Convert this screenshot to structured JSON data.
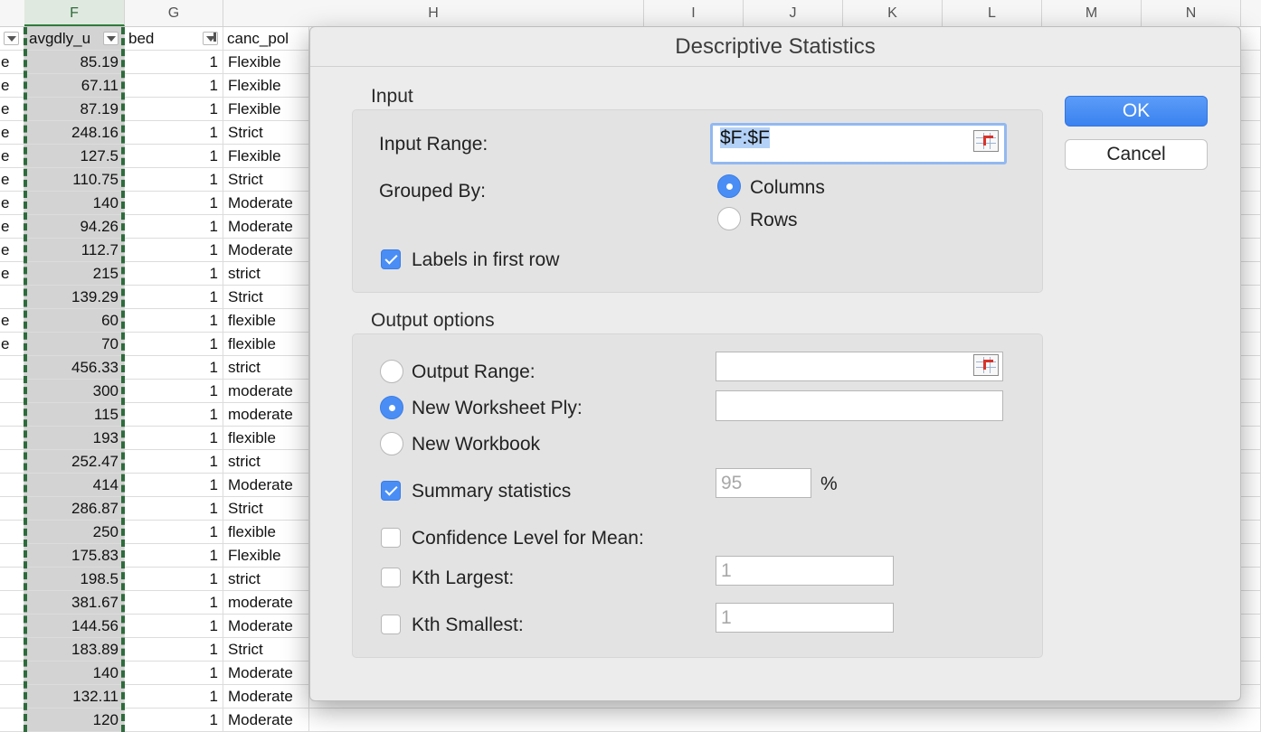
{
  "spreadsheet": {
    "column_headers": [
      "F",
      "G",
      "H",
      "I",
      "J",
      "K",
      "L",
      "M",
      "N"
    ],
    "selected_column": "F",
    "header_row": {
      "e": "",
      "f": "avgdly_u",
      "g": "bed",
      "h": "canc_pol"
    },
    "rows": [
      {
        "e": "e",
        "f": "85.19",
        "g": "1",
        "h": "Flexible"
      },
      {
        "e": "e",
        "f": "67.11",
        "g": "1",
        "h": "Flexible"
      },
      {
        "e": "e",
        "f": "87.19",
        "g": "1",
        "h": "Flexible"
      },
      {
        "e": "e",
        "f": "248.16",
        "g": "1",
        "h": "Strict"
      },
      {
        "e": "e",
        "f": "127.5",
        "g": "1",
        "h": "Flexible"
      },
      {
        "e": "e",
        "f": "110.75",
        "g": "1",
        "h": "Strict"
      },
      {
        "e": "e",
        "f": "140",
        "g": "1",
        "h": "Moderate"
      },
      {
        "e": "e",
        "f": "94.26",
        "g": "1",
        "h": "Moderate"
      },
      {
        "e": "e",
        "f": "112.7",
        "g": "1",
        "h": "Moderate"
      },
      {
        "e": "e",
        "f": "215",
        "g": "1",
        "h": "strict"
      },
      {
        "e": "",
        "f": "139.29",
        "g": "1",
        "h": "Strict"
      },
      {
        "e": "e",
        "f": "60",
        "g": "1",
        "h": "flexible"
      },
      {
        "e": "e",
        "f": "70",
        "g": "1",
        "h": "flexible"
      },
      {
        "e": "",
        "f": "456.33",
        "g": "1",
        "h": "strict"
      },
      {
        "e": "",
        "f": "300",
        "g": "1",
        "h": "moderate"
      },
      {
        "e": "",
        "f": "115",
        "g": "1",
        "h": "moderate"
      },
      {
        "e": "",
        "f": "193",
        "g": "1",
        "h": "flexible"
      },
      {
        "e": "",
        "f": "252.47",
        "g": "1",
        "h": "strict"
      },
      {
        "e": "",
        "f": "414",
        "g": "1",
        "h": "Moderate"
      },
      {
        "e": "",
        "f": "286.87",
        "g": "1",
        "h": "Strict"
      },
      {
        "e": "",
        "f": "250",
        "g": "1",
        "h": "flexible"
      },
      {
        "e": "",
        "f": "175.83",
        "g": "1",
        "h": "Flexible"
      },
      {
        "e": "",
        "f": "198.5",
        "g": "1",
        "h": "strict"
      },
      {
        "e": "",
        "f": "381.67",
        "g": "1",
        "h": "moderate"
      },
      {
        "e": "",
        "f": "144.56",
        "g": "1",
        "h": "Moderate"
      },
      {
        "e": "",
        "f": "183.89",
        "g": "1",
        "h": "Strict"
      },
      {
        "e": "",
        "f": "140",
        "g": "1",
        "h": "Moderate"
      },
      {
        "e": "",
        "f": "132.11",
        "g": "1",
        "h": "Moderate"
      },
      {
        "e": "",
        "f": "120",
        "g": "1",
        "h": "Moderate"
      }
    ]
  },
  "dialog": {
    "title": "Descriptive Statistics",
    "input": {
      "section_label": "Input",
      "input_range_label": "Input Range:",
      "input_range_value": "$F:$F",
      "grouped_by_label": "Grouped By:",
      "columns_label": "Columns",
      "rows_label": "Rows",
      "grouped_by_selected": "Columns",
      "labels_first_row_label": "Labels in first row",
      "labels_first_row_checked": true
    },
    "output": {
      "section_label": "Output options",
      "output_range_label": "Output Range:",
      "output_range_value": "",
      "new_worksheet_label": "New Worksheet Ply:",
      "new_worksheet_value": "",
      "new_workbook_label": "New Workbook",
      "selected_option": "New Worksheet Ply:",
      "summary_statistics_label": "Summary statistics",
      "summary_statistics_checked": true,
      "confidence_value": "95",
      "percent_sign": "%",
      "confidence_label": "Confidence Level for Mean:",
      "confidence_checked": false,
      "kth_largest_label": "Kth Largest:",
      "kth_largest_checked": false,
      "kth_largest_value": "1",
      "kth_smallest_label": "Kth Smallest:",
      "kth_smallest_checked": false,
      "kth_smallest_value": "1"
    },
    "buttons": {
      "ok": "OK",
      "cancel": "Cancel"
    },
    "colors": {
      "accent": "#3b82f0",
      "selection": "#b3d1f7",
      "marquee": "#2e6b3c"
    }
  }
}
